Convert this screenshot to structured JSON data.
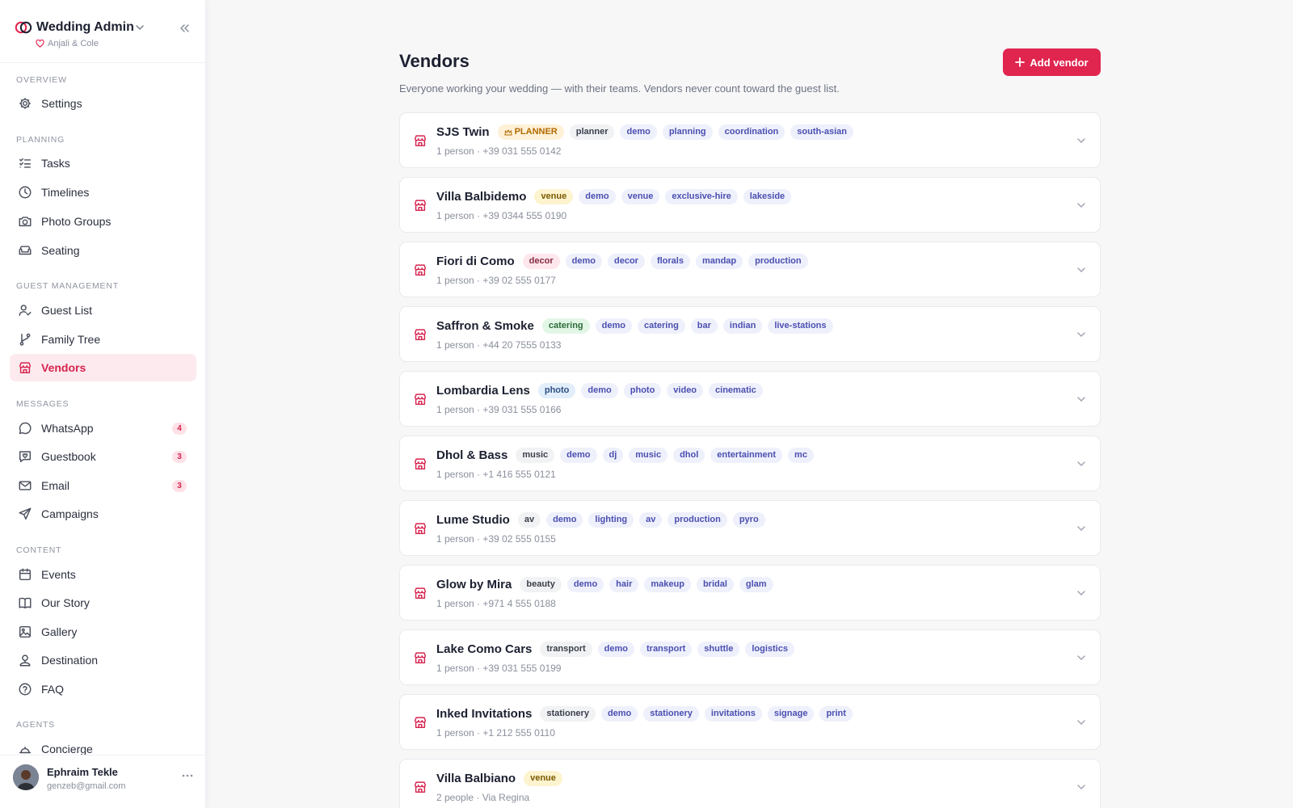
{
  "app": {
    "title": "Wedding Admin",
    "couple": "Anjali & Cole",
    "accent": "#e0254f"
  },
  "sidebar": {
    "sections": [
      {
        "label": "Overview"
      },
      {
        "label": "Planning"
      },
      {
        "label": "Guest Management"
      },
      {
        "label": "Messages"
      },
      {
        "label": "Content"
      },
      {
        "label": "Agents"
      }
    ],
    "items": [
      {
        "label": "Settings",
        "icon": "gear-icon"
      },
      {
        "label": "Tasks",
        "icon": "checklist-icon"
      },
      {
        "label": "Timelines",
        "icon": "clock-icon"
      },
      {
        "label": "Photo Groups",
        "icon": "camera-icon"
      },
      {
        "label": "Seating",
        "icon": "sofa-icon"
      },
      {
        "label": "Guest List",
        "icon": "user-check-icon"
      },
      {
        "label": "Family Tree",
        "icon": "branch-icon"
      },
      {
        "label": "Vendors",
        "icon": "store-icon",
        "active": true
      },
      {
        "label": "WhatsApp",
        "icon": "chat-bubble-icon",
        "badge": "4"
      },
      {
        "label": "Guestbook",
        "icon": "heart-message-icon",
        "badge": "3"
      },
      {
        "label": "Email",
        "icon": "mail-icon",
        "badge": "3"
      },
      {
        "label": "Campaigns",
        "icon": "send-icon"
      },
      {
        "label": "Events",
        "icon": "calendar-icon"
      },
      {
        "label": "Our Story",
        "icon": "book-icon"
      },
      {
        "label": "Gallery",
        "icon": "image-icon"
      },
      {
        "label": "Destination",
        "icon": "map-pin-icon"
      },
      {
        "label": "FAQ",
        "icon": "help-circle-icon"
      },
      {
        "label": "Concierge",
        "icon": "concierge-icon"
      }
    ]
  },
  "user": {
    "name": "Ephraim Tekle",
    "email": "genzeb@gmail.com"
  },
  "main": {
    "title": "Vendors",
    "description": "Everyone working your wedding — with their teams. Vendors never count toward the guest list.",
    "add_label": "Add vendor"
  },
  "vendors": [
    {
      "name": "SJS Twin",
      "planner": "PLANNER",
      "type": "planner",
      "tags": [
        "demo",
        "planning",
        "coordination",
        "south-asian"
      ],
      "meta": "1 person · +39 031 555 0142"
    },
    {
      "name": "Villa Balbidemo",
      "type": "venue",
      "tags": [
        "demo",
        "venue",
        "exclusive-hire",
        "lakeside"
      ],
      "meta": "1 person · +39 0344 555 0190"
    },
    {
      "name": "Fiori di Como",
      "type": "decor",
      "tags": [
        "demo",
        "decor",
        "florals",
        "mandap",
        "production"
      ],
      "meta": "1 person · +39 02 555 0177"
    },
    {
      "name": "Saffron & Smoke",
      "type": "catering",
      "tags": [
        "demo",
        "catering",
        "bar",
        "indian",
        "live-stations"
      ],
      "meta": "1 person · +44 20 7555 0133"
    },
    {
      "name": "Lombardia Lens",
      "type": "photo",
      "tags": [
        "demo",
        "photo",
        "video",
        "cinematic"
      ],
      "meta": "1 person · +39 031 555 0166"
    },
    {
      "name": "Dhol & Bass",
      "type": "music",
      "tags": [
        "demo",
        "dj",
        "music",
        "dhol",
        "entertainment",
        "mc"
      ],
      "meta": "1 person · +1 416 555 0121"
    },
    {
      "name": "Lume Studio",
      "type": "av",
      "tags": [
        "demo",
        "lighting",
        "av",
        "production",
        "pyro"
      ],
      "meta": "1 person · +39 02 555 0155"
    },
    {
      "name": "Glow by Mira",
      "type": "beauty",
      "tags": [
        "demo",
        "hair",
        "makeup",
        "bridal",
        "glam"
      ],
      "meta": "1 person · +971 4 555 0188"
    },
    {
      "name": "Lake Como Cars",
      "type": "transport",
      "tags": [
        "demo",
        "transport",
        "shuttle",
        "logistics"
      ],
      "meta": "1 person · +39 031 555 0199"
    },
    {
      "name": "Inked Invitations",
      "type": "stationery",
      "tags": [
        "demo",
        "stationery",
        "invitations",
        "signage",
        "print"
      ],
      "meta": "1 person · +1 212 555 0110"
    },
    {
      "name": "Villa Balbiano",
      "type": "venue",
      "tags": [],
      "meta": "2 people · Via Regina"
    }
  ],
  "type_colors": {
    "planner": {
      "bg": "#f1f2f4",
      "fg": "#3a3f4c"
    },
    "venue": {
      "bg": "#fdf3cf",
      "fg": "#7a5b00"
    },
    "decor": {
      "bg": "#fde7ec",
      "fg": "#8a2a40"
    },
    "catering": {
      "bg": "#e2f6e6",
      "fg": "#2d6b3a"
    },
    "photo": {
      "bg": "#e3eefb",
      "fg": "#2c4f85"
    },
    "music": {
      "bg": "#f1f2f4",
      "fg": "#3a3f4c"
    },
    "av": {
      "bg": "#f1f2f4",
      "fg": "#3a3f4c"
    },
    "beauty": {
      "bg": "#f1f2f4",
      "fg": "#3a3f4c"
    },
    "transport": {
      "bg": "#f1f2f4",
      "fg": "#3a3f4c"
    },
    "stationery": {
      "bg": "#f1f2f4",
      "fg": "#3a3f4c"
    }
  }
}
